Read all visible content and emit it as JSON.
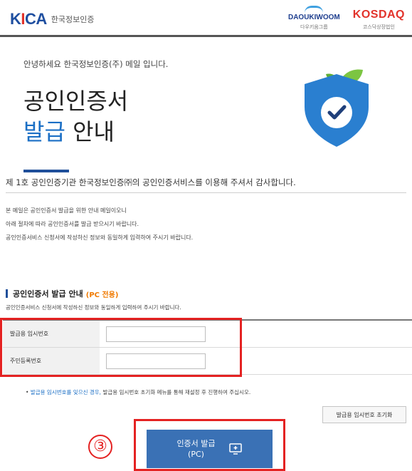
{
  "header": {
    "logo_text": "KICA",
    "logo_sub": "한국정보인증",
    "partners": [
      {
        "name": "DAOUKIWOOM",
        "sub": "다우키움그룹"
      },
      {
        "name": "KOSDAQ",
        "sub": "코스닥상장법인"
      }
    ]
  },
  "intro": {
    "greeting": "안녕하세요 한국정보인증(주) 메일 입니다.",
    "title_line1": "공인인증서",
    "title_accent": "발급",
    "title_rest": " 안내",
    "acknowledgement": "제 1호 공인인증기관 한국정보인증㈜의 공인인증서비스를 이용해 주셔서 감사합니다.",
    "body_lines": [
      "본 메일은 공인인증서 발급을 위한 안내 메일이오니",
      "아래 절차에 따라 공인인증서를 발급 받으시기 바랍니다.",
      "공인인증서비스 신청서에 작성하신 정보와 동일하게 입력하여 주시기 바랍니다."
    ]
  },
  "section": {
    "title": "공인인증서 발급 안내",
    "tag": "(PC 전용)",
    "description": "공인인증서비스 신청서에 작성하신 정보와 동일하게 입력하여 주시기 바랍니다."
  },
  "form": {
    "fields": [
      {
        "label": "발급용 임시번호",
        "value": ""
      },
      {
        "label": "주민등록번호",
        "value": ""
      }
    ]
  },
  "note": {
    "bullet": "•",
    "link": "발급용 임시번호를 잊으신 경우,",
    "rest": " 발급용 임시번호 초기화 메뉴를 통해 재설정 후 진행하여 주십시오."
  },
  "buttons": {
    "reset_label": "발급용 임시번호 초기화",
    "issue_line1": "인증서 발급",
    "issue_line2": "(PC)"
  },
  "annotation": {
    "step": "③"
  },
  "colors": {
    "brand_blue": "#1f4fa0",
    "accent_blue": "#1b6fc5",
    "button_blue": "#3a71b5",
    "highlight_red": "#e42222",
    "tag_orange": "#f07a00"
  },
  "icons": {
    "shield": "shield-check-icon",
    "monitor": "monitor-plus-icon"
  }
}
